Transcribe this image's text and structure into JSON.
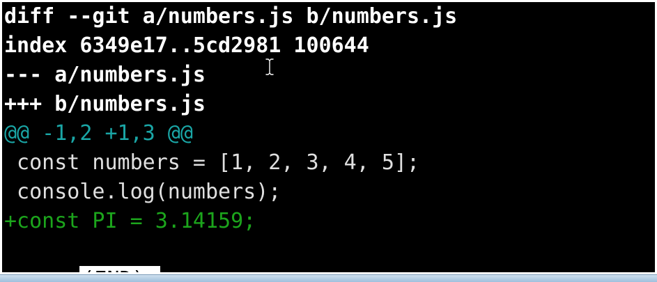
{
  "terminal": {
    "lines": [
      "diff --git a/numbers.js b/numbers.js",
      "index 6349e17..5cd2981 100644",
      "--- a/numbers.js",
      "+++ b/numbers.js",
      "@@ -1,2 +1,3 @@",
      " const numbers = [1, 2, 3, 4, 5];",
      " console.log(numbers);",
      "+const PI = 3.14159;"
    ],
    "pager_status": "(END)"
  },
  "colors": {
    "background": "#000000",
    "header_text": "#ffffff",
    "hunk_header": "#1aa6a6",
    "context_text": "#e0e0e0",
    "added_line": "#1ca51c",
    "status_bg": "#ffffff"
  },
  "icons": {
    "cursor": "text-cursor-icon"
  }
}
